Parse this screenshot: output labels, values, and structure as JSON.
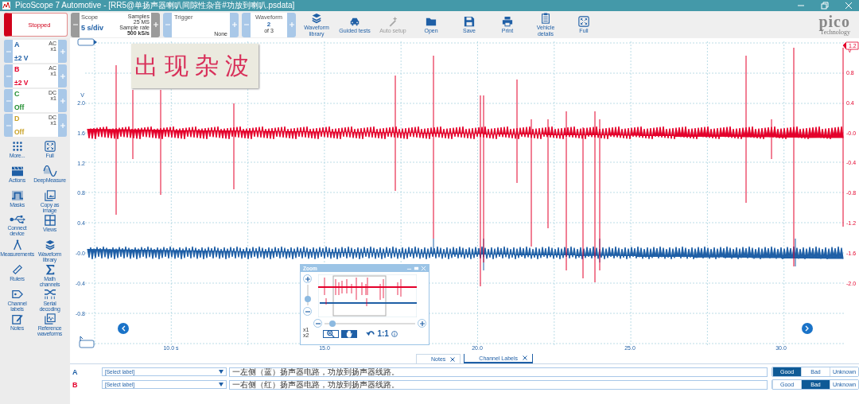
{
  "window": {
    "title": "PicoScope 7 Automotive - [RR5@单扬声器喇叭间隙性杂音#功放到喇叭.psdata]"
  },
  "run_button": {
    "label": "Stopped"
  },
  "scope": {
    "title": "Scope",
    "value": "5 s/div",
    "samples_label": "Samples",
    "samples": "25 MS",
    "rate_label": "Sample rate",
    "rate": "500 kS/s"
  },
  "trigger": {
    "title": "Trigger",
    "mode": "None"
  },
  "waveform": {
    "title": "Waveform",
    "value": "2",
    "count": "of 3"
  },
  "toolbar": [
    {
      "kind": "library",
      "label": "Waveform library",
      "disabled": false
    },
    {
      "kind": "car",
      "label": "Guided tests",
      "disabled": false
    },
    {
      "kind": "wand",
      "label": "Auto setup",
      "disabled": true
    },
    {
      "kind": "folder",
      "label": "Open",
      "disabled": false
    },
    {
      "kind": "save",
      "label": "Save",
      "disabled": false
    },
    {
      "kind": "print",
      "label": "Print",
      "disabled": false
    },
    {
      "kind": "clipboard",
      "label": "Vehicle details",
      "disabled": false
    },
    {
      "kind": "expand",
      "label": "Full",
      "disabled": false
    }
  ],
  "logo": {
    "name": "pico",
    "tagline": "Technology"
  },
  "channels": [
    {
      "name": "A",
      "coupling": "AC",
      "probe": "x1",
      "range": "±2 V",
      "color": "#1f5fa6"
    },
    {
      "name": "B",
      "coupling": "AC",
      "probe": "x1",
      "range": "±2 V",
      "color": "#e4002b"
    },
    {
      "name": "C",
      "coupling": "DC",
      "probe": "x1",
      "range": "Off",
      "color": "#1e8c2e"
    },
    {
      "name": "D",
      "coupling": "DC",
      "probe": "x1",
      "range": "Off",
      "color": "#c9a227"
    }
  ],
  "tools": [
    {
      "kind": "more",
      "label": "More..."
    },
    {
      "kind": "expand",
      "label": "Full"
    },
    {
      "kind": "actions",
      "label": "Actions"
    },
    {
      "kind": "deepmeasure",
      "label": "DeepMeasure"
    },
    {
      "kind": "masks",
      "label": "Masks"
    },
    {
      "kind": "copyimage",
      "label": "Copy as image"
    },
    {
      "kind": "usb",
      "label": "Connect device"
    },
    {
      "kind": "views",
      "label": "Views"
    },
    {
      "kind": "measure",
      "label": "Measurements"
    },
    {
      "kind": "library",
      "label": "Waveform library"
    },
    {
      "kind": "ruler",
      "label": "Rulers"
    },
    {
      "kind": "sigma",
      "label": "Math channels"
    },
    {
      "kind": "labels",
      "label": "Channel labels"
    },
    {
      "kind": "serial",
      "label": "Serial decoding"
    },
    {
      "kind": "notes",
      "label": "Notes"
    },
    {
      "kind": "reference",
      "label": "Reference waveforms"
    }
  ],
  "annotation": "出现杂波",
  "graph": {
    "left_unit": "V",
    "left_ticks": [
      "2.0",
      "1.6",
      "1.2",
      "0.8",
      "0.4",
      "-0.0",
      "-0.4",
      "-0.8"
    ],
    "right_unit": "V",
    "right_flag": "1.2",
    "right_ticks": [
      "0.8",
      "0.4",
      "-0.0",
      "-0.4",
      "-0.8",
      "-1.2",
      "-1.6",
      "-2.0"
    ],
    "x_ticks": [
      "10.0 s",
      "15.0",
      "20.0",
      "25.0",
      "30.0"
    ]
  },
  "zoom_panel": {
    "title": "Zoom",
    "vertical_zoom": {
      "level": 0.3
    },
    "horizontal_zoom": {
      "level": 0.05
    },
    "modes": [
      {
        "kind": "zoom",
        "selected": false
      },
      {
        "kind": "pan",
        "selected": true
      }
    ],
    "reset": "1:1",
    "scale_x": "x1",
    "scale_y": "x2"
  },
  "bottom_tabs": [
    {
      "label": "Notes",
      "selected": false
    },
    {
      "label": "Channel Labels",
      "selected": true
    }
  ],
  "label_rows": [
    {
      "channel": "A",
      "color": "#1f5fa6",
      "label": "[Select label]",
      "note": "一左侧（蓝）扬声器电路，功放到扬声器线路。",
      "ratings": [
        {
          "label": "Good",
          "selected": true
        },
        {
          "label": "Bad",
          "selected": false
        },
        {
          "label": "Unknown",
          "selected": false
        }
      ]
    },
    {
      "channel": "B",
      "color": "#e4002b",
      "label": "[Select label]",
      "note": "一右侧（红）扬声器电路，功放到扬声器线路。",
      "ratings": [
        {
          "label": "Good",
          "selected": false
        },
        {
          "label": "Bad",
          "selected": true
        },
        {
          "label": "Unknown",
          "selected": false
        }
      ]
    }
  ]
}
